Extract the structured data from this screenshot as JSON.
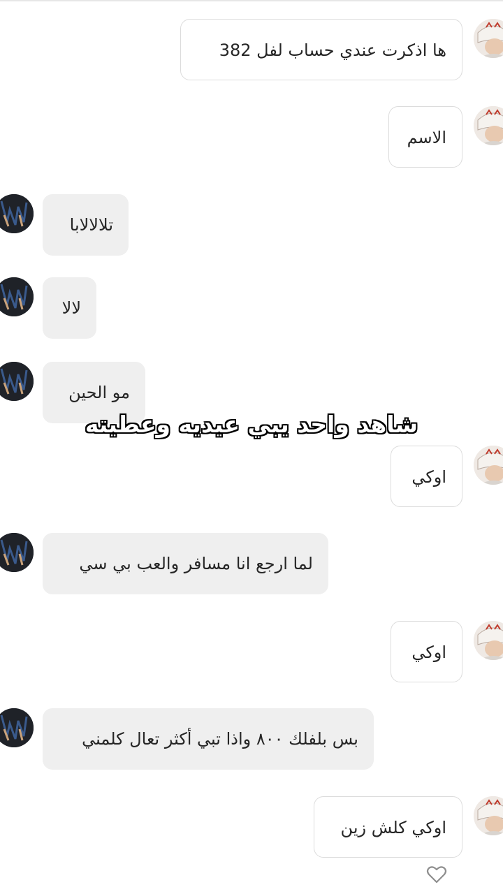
{
  "colors": {
    "outgoing_bubble_bg": "#ffffff",
    "outgoing_bubble_border": "#dcdcdc",
    "incoming_bubble_bg": "#efefef",
    "text": "#262626",
    "overlay_text": "#ffffff",
    "overlay_outline": "#000000"
  },
  "messages": [
    {
      "sender": "me",
      "text": "ها اذكرت عندي حساب لفل 382"
    },
    {
      "sender": "me",
      "text": "الاسم"
    },
    {
      "sender": "them",
      "text": "تلالالابا"
    },
    {
      "sender": "them",
      "text": "لالا"
    },
    {
      "sender": "them",
      "text": "مو الحين"
    },
    {
      "sender": "me",
      "text": "اوكي"
    },
    {
      "sender": "them",
      "text": "لما ارجع انا مسافر والعب بي سي"
    },
    {
      "sender": "me",
      "text": "اوكي"
    },
    {
      "sender": "them",
      "text": "بس بلفلك ٨٠٠ واذا تبي أكثر تعال كلمني"
    },
    {
      "sender": "me",
      "text": "اوكي كلش زين"
    }
  ],
  "overlay_caption": "شاهد واحد يبي عيديه وعطيته",
  "icons": {
    "outgoing_avatar": "avatar-white-haired-character",
    "incoming_avatar": "avatar-dark-haired-character",
    "like": "heart-outline-icon"
  }
}
